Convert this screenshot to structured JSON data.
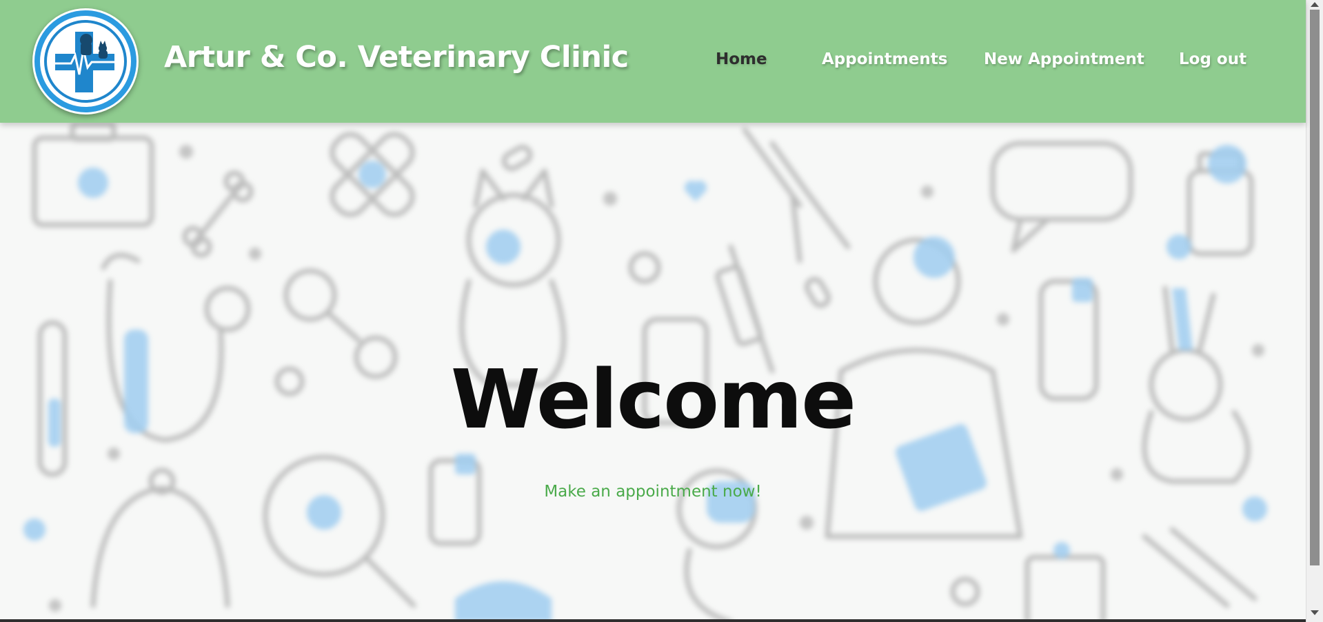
{
  "header": {
    "brand": "Artur & Co. Veterinary Clinic",
    "logo_icon": "vet-clinic-logo-icon",
    "bg_color": "#8fcc8f"
  },
  "nav": {
    "items": [
      {
        "label": "Home",
        "active": true
      },
      {
        "label": "Appointments",
        "active": false
      },
      {
        "label": "New Appointment",
        "active": false
      },
      {
        "label": "Log out",
        "active": false
      }
    ]
  },
  "hero": {
    "title": "Welcome",
    "subtitle": "Make an appointment now!",
    "subtitle_color": "#4aaa4a",
    "background": "blurred-veterinary-doodle-pattern"
  }
}
